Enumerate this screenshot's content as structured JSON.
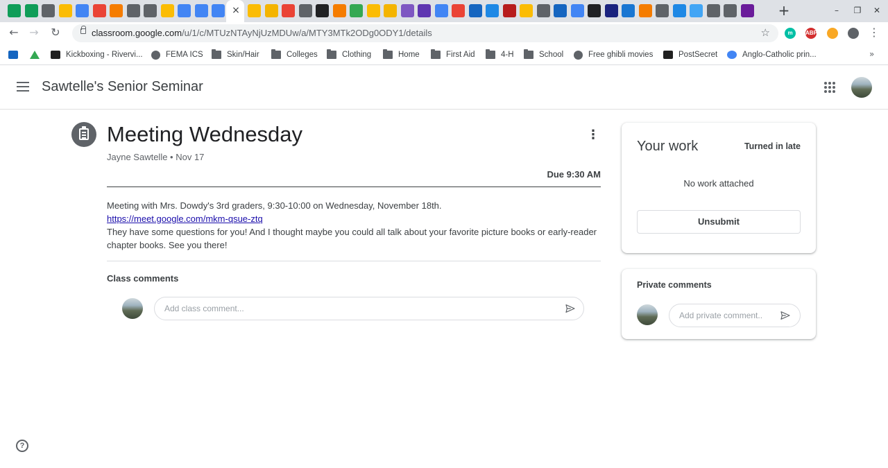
{
  "browser": {
    "tab_favicon_colors": [
      "#0f9d58",
      "#0f9d58",
      "#5f6368",
      "#fbbc04",
      "#4285f4",
      "#ea4335",
      "#f57c00",
      "#5f6368",
      "#5f6368",
      "#fbbc04",
      "#4285f4",
      "#4285f4",
      "#4285f4",
      "#fbbc04",
      "#f4b400",
      "#ea4335",
      "#5f6368",
      "#202124",
      "#f57c00",
      "#34a853",
      "#fbbc04",
      "#f4b400",
      "#7e57c2",
      "#5e35b1",
      "#4285f4",
      "#ea4335",
      "#1565c0",
      "#1e88e5",
      "#b71c1c",
      "#fbbc04",
      "#5f6368",
      "#1565c0",
      "#4285f4",
      "#202124",
      "#1a237e",
      "#1976d2",
      "#f57c00",
      "#5f6368",
      "#1e88e5",
      "#42a5f5",
      "#5f6368",
      "#5f6368",
      "#6a1b9a"
    ],
    "active_tab_close": "×",
    "new_tab": "+",
    "window_buttons": [
      "–",
      "❐",
      "✕"
    ],
    "url_host": "classroom.google.com",
    "url_path": "/u/1/c/MTUzNTAyNjUzMDUw/a/MTY3MTk2ODg0ODY1/details",
    "extensions": [
      {
        "label": "m",
        "color": "#00bfa5"
      },
      {
        "label": "ABP",
        "color": "#d32f2f"
      },
      {
        "label": "",
        "color": "#f9a825"
      },
      {
        "label": "",
        "color": "#5f6368"
      }
    ],
    "bookmarks": [
      {
        "label": "",
        "icon": "ox"
      },
      {
        "label": "",
        "icon": "drive"
      },
      {
        "label": "Kickboxing - Rivervi...",
        "icon": "site"
      },
      {
        "label": "FEMA ICS",
        "icon": "globe"
      },
      {
        "label": "Skin/Hair",
        "icon": "folder"
      },
      {
        "label": "Colleges",
        "icon": "folder"
      },
      {
        "label": "Clothing",
        "icon": "folder"
      },
      {
        "label": "Home",
        "icon": "folder"
      },
      {
        "label": "First Aid",
        "icon": "folder"
      },
      {
        "label": "4-H",
        "icon": "folder"
      },
      {
        "label": "School",
        "icon": "folder"
      },
      {
        "label": "Free ghibli movies",
        "icon": "globe"
      },
      {
        "label": "PostSecret",
        "icon": "site"
      },
      {
        "label": "Anglo-Catholic prin...",
        "icon": "google"
      }
    ],
    "bookmarks_more": "»"
  },
  "classroom": {
    "class_name": "Sawtelle's Senior Seminar",
    "assignment": {
      "title": "Meeting Wednesday",
      "meta": "Jayne Sawtelle • Nov 17",
      "due": "Due 9:30 AM",
      "description_line1": "Meeting with Mrs. Dowdy's 3rd graders, 9:30-10:00 on Wednesday, November 18th.",
      "link": "https://meet.google.com/mkm-qsue-ztq",
      "description_line2": "They have some questions for you! And I thought maybe you could all talk about your favorite picture books or early-reader chapter books. See you there!"
    },
    "class_comments": {
      "label": "Class comments",
      "placeholder": "Add class comment..."
    },
    "your_work": {
      "title": "Your work",
      "status": "Turned in late",
      "empty_text": "No work attached",
      "unsubmit_label": "Unsubmit"
    },
    "private_comments": {
      "label": "Private comments",
      "placeholder": "Add private comment..."
    },
    "help_label": "?"
  }
}
